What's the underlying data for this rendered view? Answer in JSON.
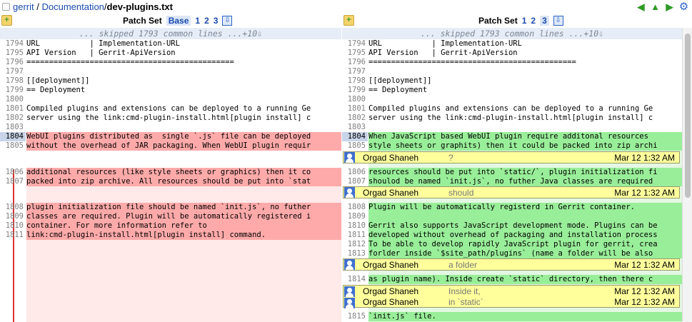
{
  "breadcrumb": {
    "root": "gerrit",
    "sep": " / ",
    "dir": "Documentation",
    "file": "dev-plugins.txt"
  },
  "nav_icons": [
    "arrow-left-icon",
    "arrow-up-icon",
    "arrow-right-icon",
    "gear-icon"
  ],
  "left_header": {
    "label": "Patch Set",
    "sets": [
      "Base",
      "1",
      "2",
      "3"
    ],
    "selected": "Base"
  },
  "right_header": {
    "label": "Patch Set",
    "sets": [
      "1",
      "2",
      "3"
    ],
    "selected": "3"
  },
  "skip_text": "... skipped 1793 common lines ...+10⇩",
  "left_lines": [
    {
      "n": "1794",
      "t": "URL           | Implementation-URL"
    },
    {
      "n": "1795",
      "t": "API Version   | Gerrit-ApiVersion"
    },
    {
      "n": "1796",
      "t": "=============================================="
    },
    {
      "n": "1797",
      "t": ""
    },
    {
      "n": "1798",
      "t": "[[deployment]]"
    },
    {
      "n": "1799",
      "t": "== Deployment"
    },
    {
      "n": "1800",
      "t": ""
    },
    {
      "n": "1801",
      "t": "Compiled plugins and extensions can be deployed to a running Ge"
    },
    {
      "n": "1802",
      "t": "server using the link:cmd-plugin-install.html[plugin install] c"
    },
    {
      "n": "1803",
      "t": ""
    },
    {
      "n": "1804",
      "t": "WebUI plugins distributed as  single `.js` file can be deployed"
    },
    {
      "n": "1805",
      "t": "without the overhead of JAR packaging. When WebUI plugin requir"
    },
    {
      "n": "1806",
      "t": "additional resources (like style sheets or graphics) then it co"
    },
    {
      "n": "1807",
      "t": "packed into zip archive. All resources should be put into `stat"
    },
    {
      "n": "1808",
      "t": "plugin initialization file should be named `init.js`, no futher"
    },
    {
      "n": "1809",
      "t": "classes are required. Plugin will be automatically registered i"
    },
    {
      "n": "1810",
      "t": "container. For more information refer to"
    },
    {
      "n": "1811",
      "t": "link:cmd-plugin-install.html[plugin install] command."
    }
  ],
  "right_lines": [
    {
      "n": "1794",
      "t": "URL           | Implementation-URL"
    },
    {
      "n": "1795",
      "t": "API Version   | Gerrit-ApiVersion"
    },
    {
      "n": "1796",
      "t": "=============================================="
    },
    {
      "n": "1797",
      "t": ""
    },
    {
      "n": "1798",
      "t": "[[deployment]]"
    },
    {
      "n": "1799",
      "t": "== Deployment"
    },
    {
      "n": "1800",
      "t": ""
    },
    {
      "n": "1801",
      "t": "Compiled plugins and extensions can be deployed to a running Ge"
    },
    {
      "n": "1802",
      "t": "server using the link:cmd-plugin-install.html[plugin install] c"
    },
    {
      "n": "1803",
      "t": ""
    },
    {
      "n": "1804",
      "t": "When JavaScript based WebUI plugin require additonal resources "
    },
    {
      "n": "1805",
      "t": "style sheets or graphits) then it could be packed into zip archi"
    },
    {
      "n": "1806",
      "t": "resources should be put into `static/`, plugin initialization fi"
    },
    {
      "n": "1807",
      "t": "shoulod be named `init.js`, no futher Java classes are required"
    },
    {
      "n": "1808",
      "t": "Plugin will be automatically registerd in Gerrit container."
    },
    {
      "n": "1809",
      "t": ""
    },
    {
      "n": "1810",
      "t": "Gerrit also supports JavaScript development mode. Plugins can be"
    },
    {
      "n": "1811",
      "t": "developed without overhead of packaging and installation process"
    },
    {
      "n": "1812",
      "t": "To be able to develop rapidly JavaScript plugin for gerrit, crea"
    },
    {
      "n": "1813",
      "t": "forlder inside `$site_path/plugins` (name a folder will be also "
    },
    {
      "n": "1814",
      "t": "as plugin name). Inside create `static` directory, then there c"
    },
    {
      "n": "1815",
      "t": "`init.js` file."
    }
  ],
  "comments": [
    {
      "author": "Orgad Shaneh",
      "message": "?",
      "date": "Mar 12 1:32 AM"
    },
    {
      "author": "Orgad Shaneh",
      "message": "should",
      "date": "Mar 12 1:32 AM"
    },
    {
      "author": "Orgad Shaneh",
      "message": "a folder",
      "date": "Mar 12 1:32 AM"
    },
    {
      "author": "Orgad Shaneh",
      "message": "Inside it,",
      "date": "Mar 12 1:32 AM"
    },
    {
      "author": "Orgad Shaneh",
      "message": "in `static`",
      "date": "Mar 12 1:32 AM"
    }
  ],
  "colors": {
    "deleted": "#ffaaaa",
    "inserted": "#99ee99",
    "comment_bg": "#ffff9c",
    "highlight": "#f6b600"
  }
}
